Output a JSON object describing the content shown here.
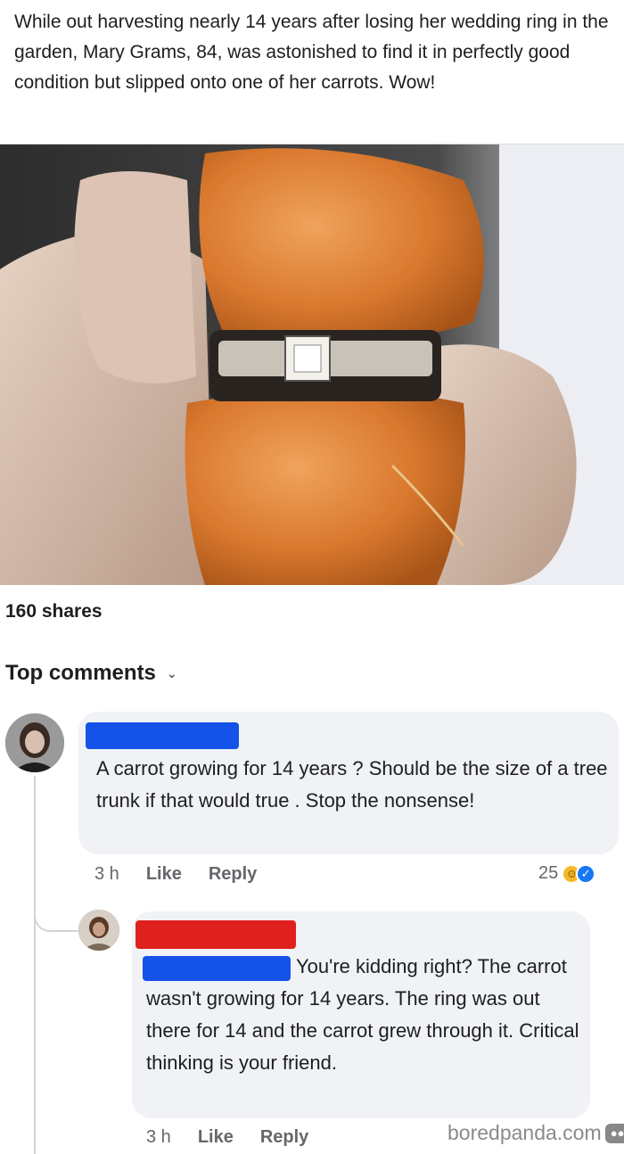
{
  "post": {
    "text": "While out harvesting nearly 14 years after losing her wedding ring in the garden, Mary Grams, 84, was astonished to find it in perfectly good condition but slipped onto one of her carrots. Wow!"
  },
  "shares": "160 shares",
  "comments_section": {
    "title": "Top comments"
  },
  "comments": [
    {
      "text": "A carrot growing for 14 years ? Should be the size of a tree trunk if that would true . Stop the nonsense!",
      "time": "3 h",
      "like": "Like",
      "reply": "Reply",
      "reaction_count": "25",
      "reactions": [
        "haha-icon",
        "like-icon"
      ]
    },
    {
      "text": "You're kidding right? The carrot wasn't growing for 14 years. The ring was out there for 14 and the carrot grew through it. Critical thinking is your friend.",
      "time": "3 h",
      "like": "Like",
      "reply": "Reply"
    }
  ],
  "watermark": "boredpanda.com",
  "colors": {
    "redact_blue": "#1552e8",
    "redact_red": "#e0201c",
    "bubble": "#f0f2f5",
    "meta_text": "#65676b"
  }
}
